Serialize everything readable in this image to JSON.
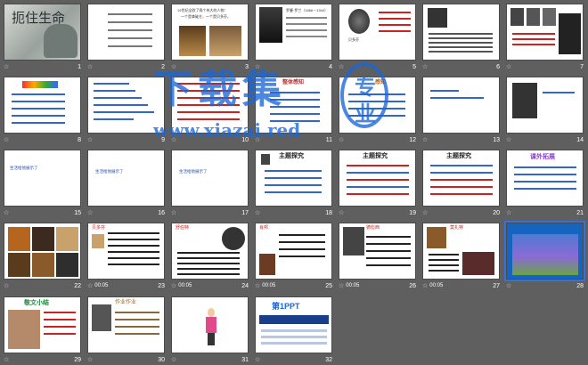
{
  "slides": [
    {
      "n": "1",
      "time": ""
    },
    {
      "n": "2",
      "time": ""
    },
    {
      "n": "3",
      "time": ""
    },
    {
      "n": "4",
      "time": ""
    },
    {
      "n": "5",
      "time": ""
    },
    {
      "n": "6",
      "time": ""
    },
    {
      "n": "7",
      "time": ""
    },
    {
      "n": "8",
      "time": ""
    },
    {
      "n": "9",
      "time": ""
    },
    {
      "n": "10",
      "time": ""
    },
    {
      "n": "11",
      "time": ""
    },
    {
      "n": "12",
      "time": ""
    },
    {
      "n": "13",
      "time": ""
    },
    {
      "n": "14",
      "time": ""
    },
    {
      "n": "15",
      "time": ""
    },
    {
      "n": "16",
      "time": ""
    },
    {
      "n": "17",
      "time": ""
    },
    {
      "n": "18",
      "time": ""
    },
    {
      "n": "19",
      "time": ""
    },
    {
      "n": "20",
      "time": ""
    },
    {
      "n": "21",
      "time": ""
    },
    {
      "n": "22",
      "time": ""
    },
    {
      "n": "23",
      "time": "00:05"
    },
    {
      "n": "24",
      "time": "00:05"
    },
    {
      "n": "25",
      "time": "00:05"
    },
    {
      "n": "26",
      "time": "00:05"
    },
    {
      "n": "27",
      "time": "00:05"
    },
    {
      "n": "28",
      "time": ""
    },
    {
      "n": "29",
      "time": ""
    },
    {
      "n": "30",
      "time": ""
    },
    {
      "n": "31",
      "time": ""
    },
    {
      "n": "32",
      "time": ""
    }
  ],
  "text": {
    "s1_title": "扼住生命",
    "s3_line1": "19世纪全欧了两个伟大的人物：",
    "s3_line2": "一个是拿破仑，一个是贝多芬。",
    "s3_line3": "—— 勃兰兑斯",
    "s4_name": "罗曼·罗兰（1866－1944）",
    "s5_name": "贝多芬",
    "s11_title": "整体感知",
    "s12_title": "感知",
    "s18_title": "主题探究",
    "s19_title": "主题探究",
    "s20_title": "主题探究",
    "s21_title": "课外拓展",
    "s23_title": "贝多芬",
    "s24_title": "舒伯特",
    "s25_title": "肖邦",
    "s26_title": "德彪西",
    "s27_title": "莫扎特",
    "s29_title": "敬文小结",
    "s30_title": "作业作业",
    "s32_title": "第1PPT",
    "s16_line1": "生活给他展示了",
    "s17_line1": "生活给他展示了",
    "s15_line1": "生活给他展示了"
  },
  "watermark": {
    "line1": "下载集",
    "badge1": "专",
    "badge2": "业",
    "url": "www.xiazai.red"
  },
  "colors": {
    "bg": "#5f5f5f",
    "watermark": "#1a67d8",
    "selected": "#3a6fd8",
    "slide28_bg": "#1565c0"
  }
}
